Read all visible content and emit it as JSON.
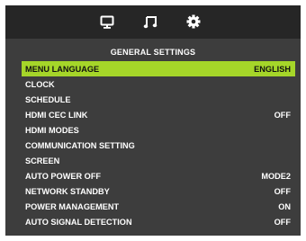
{
  "tabs": [
    {
      "icon": "monitor-icon"
    },
    {
      "icon": "music-note-icon"
    },
    {
      "icon": "gear-icon"
    }
  ],
  "colors": {
    "panel_bg": "#3d3d3d",
    "tab_bar_bg": "#262626",
    "highlight": "#a5d629",
    "text": "#ffffff"
  },
  "title": "GENERAL  SETTINGS",
  "menu": [
    {
      "label": "MENU LANGUAGE",
      "value": "ENGLISH",
      "selected": true
    },
    {
      "label": "CLOCK",
      "value": ""
    },
    {
      "label": "SCHEDULE",
      "value": ""
    },
    {
      "label": "HDMI CEC LINK",
      "value": "OFF"
    },
    {
      "label": "HDMI MODES",
      "value": ""
    },
    {
      "label": "COMMUNICATION SETTING",
      "value": ""
    },
    {
      "label": "SCREEN",
      "value": ""
    },
    {
      "label": "AUTO POWER OFF",
      "value": "MODE2"
    },
    {
      "label": "NETWORK STANDBY",
      "value": "OFF"
    },
    {
      "label": "POWER MANAGEMENT",
      "value": "ON"
    },
    {
      "label": "AUTO SIGNAL DETECTION",
      "value": "OFF"
    }
  ]
}
